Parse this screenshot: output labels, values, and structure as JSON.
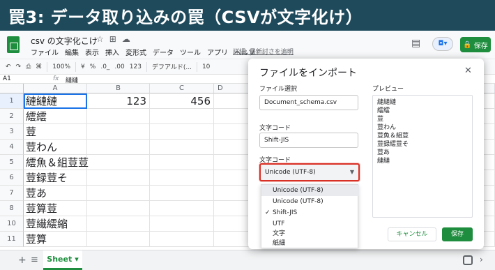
{
  "banner": {
    "text": "罠3: データ取り込みの罠（CSVが文字化け）"
  },
  "app": {
    "doc_title": "csv の文字化こけ",
    "menu": [
      "ファイル",
      "編集",
      "表示",
      "挿入",
      "変形式",
      "データ",
      "ツール",
      "アプリ",
      "ヘルプ"
    ],
    "last_edit": "詳細: 最新討さを追明",
    "share_label": "保存"
  },
  "toolbar": {
    "zoom": "100%",
    "currency": "¥",
    "percent": "%",
    "dec_less": ".0_",
    "dec_more": ".00",
    "format": "123",
    "font": "デフアルド(...",
    "font_size": "10"
  },
  "formula_bar": {
    "cell_ref": "A1",
    "fx": "fx",
    "value": "縺縺"
  },
  "grid": {
    "columns": [
      "A",
      "B",
      "C",
      "D"
    ],
    "rows": [
      {
        "num": "1",
        "a": "縺縺縺",
        "b": "123",
        "c": "456"
      },
      {
        "num": "2",
        "a": "繧繧",
        "b": "",
        "c": ""
      },
      {
        "num": "3",
        "a": "荳",
        "b": "",
        "c": ""
      },
      {
        "num": "4",
        "a": "荳わん",
        "b": "",
        "c": ""
      },
      {
        "num": "5",
        "a": "繧魚＆組荳荳",
        "b": "",
        "c": ""
      },
      {
        "num": "6",
        "a": "荳録荳そ",
        "b": "",
        "c": ""
      },
      {
        "num": "7",
        "a": "荳あ",
        "b": "",
        "c": ""
      },
      {
        "num": "8",
        "a": "荳算荳",
        "b": "",
        "c": ""
      },
      {
        "num": "10",
        "a": "荳繊繧縮",
        "b": "",
        "c": ""
      },
      {
        "num": "11",
        "a": "荳算",
        "b": "",
        "c": ""
      }
    ]
  },
  "sheets": {
    "active": "Sheet"
  },
  "dialog": {
    "title": "ファイルをインポート",
    "file_label": "ファイル選択",
    "file_value": "Document_schema.csv",
    "encoding_label_1": "文字コード",
    "encoding_value_1": "Shift-JIS",
    "encoding_label_2": "文字コード",
    "encoding_value_2": "Unicode (UTF-8)",
    "dropdown_options": [
      "Unicode (UTF-8)",
      "Unicode (UTF-8)",
      "Shift-JIS",
      "UTF",
      "文字",
      "紙細"
    ],
    "checked_option": "✓",
    "preview_label": "プレビュー",
    "preview_lines": [
      "縺縺縺",
      "繧繧",
      "荳",
      "荳わん",
      "荳魚＆組荳",
      "荳録繧荳そ",
      "荳あ",
      "縺縺"
    ],
    "cancel_label": "キャンセル",
    "import_label": "保存"
  },
  "colors": {
    "banner": "#1e4a5c",
    "accent_green": "#1e8e3e",
    "highlight_red": "#d93025",
    "selection_blue": "#1a73e8"
  }
}
